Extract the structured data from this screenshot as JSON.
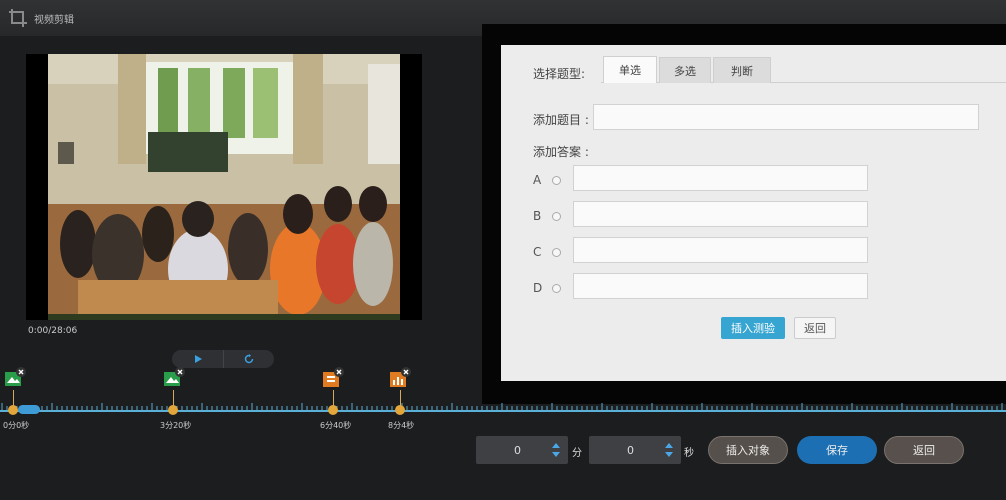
{
  "window": {
    "title": "视频剪辑"
  },
  "player": {
    "timecode": "0:00/28:06"
  },
  "quiz": {
    "type_label": "选择题型:",
    "tabs": [
      {
        "label": "单选"
      },
      {
        "label": "多选"
      },
      {
        "label": "判断"
      }
    ],
    "active_tab": "单选",
    "question_label": "添加题目 :",
    "question_value": "",
    "answer_label": "添加答案 :",
    "options": [
      {
        "letter": "A",
        "value": ""
      },
      {
        "letter": "B",
        "value": ""
      },
      {
        "letter": "C",
        "value": ""
      },
      {
        "letter": "D",
        "value": ""
      }
    ],
    "insert_button": "插入测验",
    "return_button": "返回"
  },
  "timeline": {
    "markers": [
      {
        "time": "0分0秒",
        "icon": "image-icon",
        "color": "#2a9d4b"
      },
      {
        "time": "3分20秒",
        "icon": "image-icon",
        "color": "#2a9d4b"
      },
      {
        "time": "6分40秒",
        "icon": "document-icon",
        "color": "#e07b22"
      },
      {
        "time": "8分4秒",
        "icon": "chart-icon",
        "color": "#e07b22"
      }
    ]
  },
  "bottom": {
    "minutes_value": "0",
    "minutes_unit": "分",
    "seconds_value": "0",
    "seconds_unit": "秒",
    "insert_object": "插入对象",
    "save": "保存",
    "back": "返回"
  },
  "colors": {
    "accent": "#37a5d2",
    "save": "#1d6fb3",
    "timeline": "#5ab0d6",
    "marker": "#e3a63b"
  }
}
